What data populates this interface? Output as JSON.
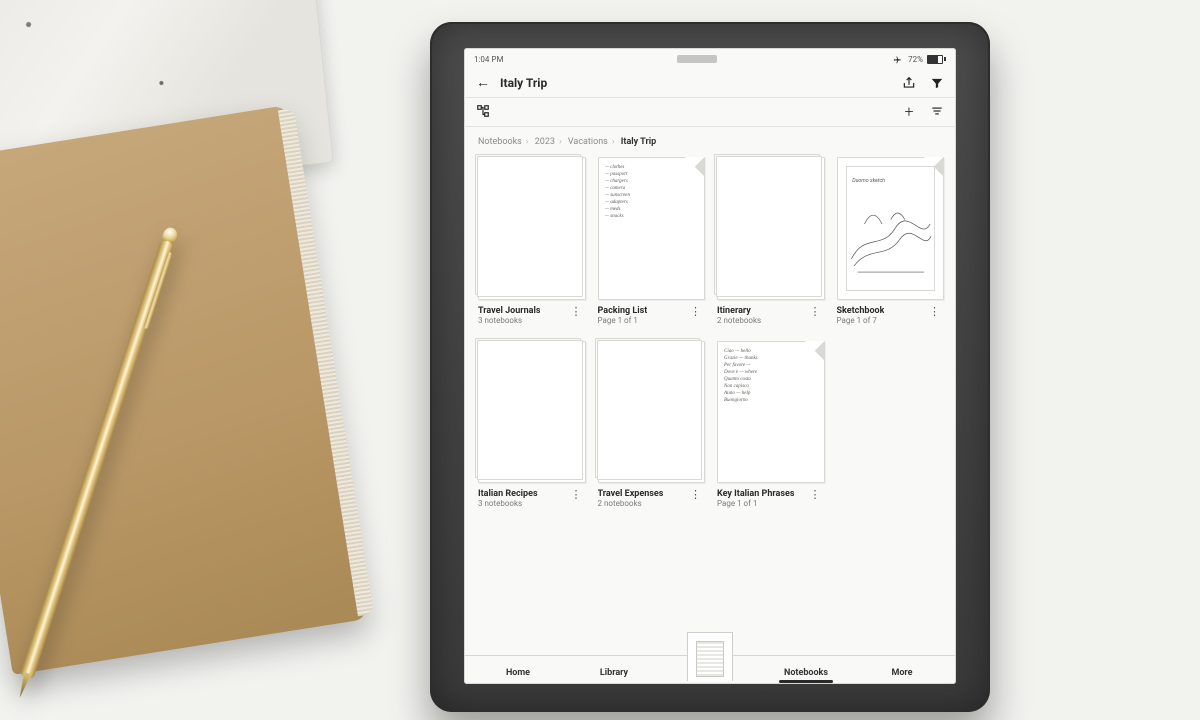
{
  "status": {
    "time": "1:04 PM",
    "battery_pct": "72%"
  },
  "header": {
    "title": "Italy Trip"
  },
  "breadcrumb": {
    "parts": [
      "Notebooks",
      "2023",
      "Vacations"
    ],
    "current": "Italy Trip"
  },
  "notes": [
    {
      "name": "Travel Journals",
      "sub": "3 notebooks",
      "kind": "folder"
    },
    {
      "name": "Packing List",
      "sub": "Page 1 of 1",
      "kind": "page-text"
    },
    {
      "name": "Itinerary",
      "sub": "2 notebooks",
      "kind": "folder"
    },
    {
      "name": "Sketchbook",
      "sub": "Page 1 of 7",
      "kind": "page-sketch"
    },
    {
      "name": "Italian Recipes",
      "sub": "3 notebooks",
      "kind": "folder"
    },
    {
      "name": "Travel Expenses",
      "sub": "2 notebooks",
      "kind": "folder"
    },
    {
      "name": "Key Italian Phrases",
      "sub": "Page 1 of 1",
      "kind": "page-text"
    }
  ],
  "nav": {
    "items": [
      "Home",
      "Library",
      "Notebooks",
      "More"
    ],
    "active_index": 2
  },
  "icons": {
    "back": "←",
    "share": "share-icon",
    "filter": "filter-icon",
    "tree": "tree-icon",
    "add": "+",
    "sort": "sort-icon",
    "airplane": "airplane-icon",
    "kebab": "⋮"
  }
}
